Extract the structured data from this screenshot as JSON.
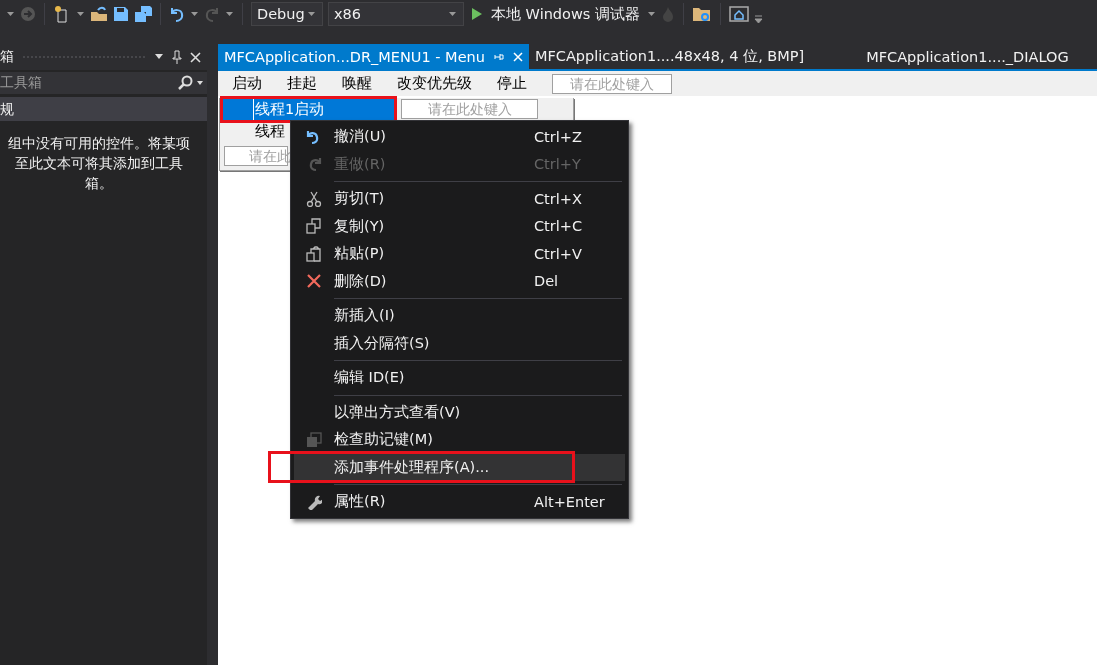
{
  "toolbar": {
    "config": "Debug",
    "platform": "x86",
    "run_label": "本地 Windows 调试器"
  },
  "toolbox": {
    "title": "箱",
    "search_placeholder": "工具箱",
    "group": "规",
    "message_lines": [
      "组中没有可用的控件。将某项",
      "至此文本可将其添加到工具",
      "箱。"
    ]
  },
  "tabs": [
    {
      "label": "MFCApplication...DR_MENU1 - Menu",
      "selected": true
    },
    {
      "label": "MFCApplication1....48x48, 4 位, BMP]",
      "selected": false
    },
    {
      "label": "MFCApplication1...._DIALOG",
      "selected": false
    }
  ],
  "menu_bar": {
    "items": [
      "启动",
      "挂起",
      "唤醒",
      "改变优先级",
      "停止"
    ],
    "placeholder": "请在此处键入"
  },
  "dropdown": {
    "items": [
      {
        "label": "线程1启动",
        "selected": true,
        "annotated": true
      },
      {
        "label": "线程",
        "selected": false,
        "annotated": false
      }
    ],
    "side_placeholder": "请在此处键入",
    "placeholder": "请在此"
  },
  "context_menu": {
    "items": [
      {
        "kind": "item",
        "label": "撤消(U)",
        "shortcut": "Ctrl+Z",
        "disabled": false,
        "hover": false,
        "annotated": false
      },
      {
        "kind": "item",
        "label": "重做(R)",
        "shortcut": "Ctrl+Y",
        "disabled": true,
        "hover": false,
        "annotated": false
      },
      {
        "kind": "separator"
      },
      {
        "kind": "item",
        "label": "剪切(T)",
        "shortcut": "Ctrl+X",
        "disabled": false,
        "hover": false,
        "annotated": false
      },
      {
        "kind": "item",
        "label": "复制(Y)",
        "shortcut": "Ctrl+C",
        "disabled": false,
        "hover": false,
        "annotated": false
      },
      {
        "kind": "item",
        "label": "粘贴(P)",
        "shortcut": "Ctrl+V",
        "disabled": false,
        "hover": false,
        "annotated": false
      },
      {
        "kind": "item",
        "label": "删除(D)",
        "shortcut": "Del",
        "disabled": false,
        "hover": false,
        "annotated": false
      },
      {
        "kind": "separator"
      },
      {
        "kind": "item",
        "label": "新插入(I)",
        "disabled": false,
        "hover": false,
        "annotated": false
      },
      {
        "kind": "item",
        "label": "插入分隔符(S)",
        "disabled": false,
        "hover": false,
        "annotated": false
      },
      {
        "kind": "separator"
      },
      {
        "kind": "item",
        "label": "编辑 ID(E)",
        "disabled": false,
        "hover": false,
        "annotated": false
      },
      {
        "kind": "separator"
      },
      {
        "kind": "item",
        "label": "以弹出方式查看(V)",
        "disabled": false,
        "hover": false,
        "annotated": false
      },
      {
        "kind": "item",
        "label": "检查助记键(M)",
        "disabled": false,
        "hover": false,
        "annotated": false
      },
      {
        "kind": "item",
        "label": "添加事件处理程序(A)...",
        "disabled": false,
        "hover": true,
        "annotated": true
      },
      {
        "kind": "separator"
      },
      {
        "kind": "item",
        "label": "属性(R)",
        "shortcut": "Alt+Enter",
        "disabled": false,
        "hover": false,
        "annotated": false
      }
    ]
  }
}
